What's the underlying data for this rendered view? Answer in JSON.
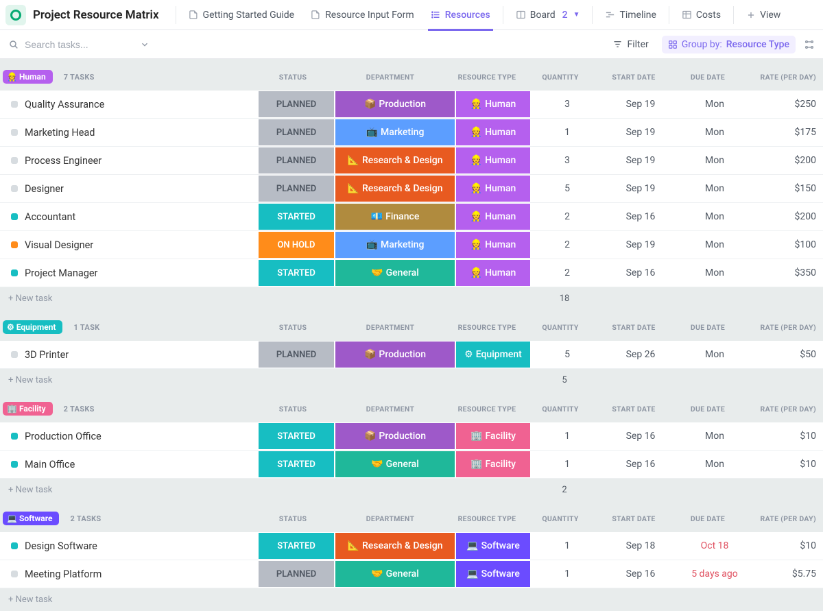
{
  "header": {
    "title": "Project Resource Matrix",
    "tabs": [
      {
        "label": "Getting Started Guide",
        "icon": "📄"
      },
      {
        "label": "Resource Input Form",
        "icon": "📄"
      },
      {
        "label": "Resources",
        "icon": "list",
        "active": true
      },
      {
        "label": "Board",
        "icon": "board",
        "count": "2"
      },
      {
        "label": "Timeline",
        "icon": "timeline"
      },
      {
        "label": "Costs",
        "icon": "table"
      },
      {
        "label": "View",
        "icon": "plus"
      }
    ]
  },
  "toolbar": {
    "search_placeholder": "Search tasks...",
    "filter": "Filter",
    "group_label": "Group by:",
    "group_value": "Resource Type"
  },
  "columns": [
    "STATUS",
    "DEPARTMENT",
    "RESOURCE TYPE",
    "QUANTITY",
    "START DATE",
    "DUE DATE",
    "RATE (PER DAY)"
  ],
  "colors": {
    "status": {
      "PLANNED": "#b7bcc5",
      "STARTED": "#17bec2",
      "ON HOLD": "#ff8c1a"
    },
    "dept": {
      "Production": "#9e59c9",
      "Marketing": "#5c9eff",
      "Research & Design": "#e85a20",
      "Finance": "#b08b3e",
      "General": "#1fb89a"
    },
    "restype": {
      "Human": "#b560ee",
      "Equipment": "#17bec2",
      "Facility": "#f06292",
      "Software": "#6b4cff"
    },
    "groups": {
      "Human": "#b560ee",
      "Equipment": "#17bec2",
      "Facility": "#f06292",
      "Software": "#6b4cff"
    }
  },
  "groups": [
    {
      "name": "Human",
      "emoji": "👷",
      "count": "7 TASKS",
      "rows": [
        {
          "name": "Quality Assurance",
          "dot": "#d7dce0",
          "status": "PLANNED",
          "dept": "Production",
          "dept_emoji": "📦",
          "restype": "Human",
          "restype_emoji": "👷",
          "qty": "3",
          "start": "Sep 19",
          "due": "Mon",
          "rate": "$250"
        },
        {
          "name": "Marketing Head",
          "dot": "#d7dce0",
          "status": "PLANNED",
          "dept": "Marketing",
          "dept_emoji": "📺",
          "restype": "Human",
          "restype_emoji": "👷",
          "qty": "1",
          "start": "Sep 19",
          "due": "Mon",
          "rate": "$175"
        },
        {
          "name": "Process Engineer",
          "dot": "#d7dce0",
          "status": "PLANNED",
          "dept": "Research & Design",
          "dept_emoji": "📐",
          "restype": "Human",
          "restype_emoji": "👷",
          "qty": "3",
          "start": "Sep 19",
          "due": "Mon",
          "rate": "$200"
        },
        {
          "name": "Designer",
          "dot": "#d7dce0",
          "status": "PLANNED",
          "dept": "Research & Design",
          "dept_emoji": "📐",
          "restype": "Human",
          "restype_emoji": "👷",
          "qty": "5",
          "start": "Sep 19",
          "due": "Mon",
          "rate": "$150"
        },
        {
          "name": "Accountant",
          "dot": "#17bec2",
          "status": "STARTED",
          "dept": "Finance",
          "dept_emoji": "💶",
          "restype": "Human",
          "restype_emoji": "👷",
          "qty": "2",
          "start": "Sep 16",
          "due": "Mon",
          "rate": "$200"
        },
        {
          "name": "Visual Designer",
          "dot": "#ff8c1a",
          "status": "ON HOLD",
          "dept": "Marketing",
          "dept_emoji": "📺",
          "restype": "Human",
          "restype_emoji": "👷",
          "qty": "2",
          "start": "Sep 19",
          "due": "Mon",
          "rate": "$100"
        },
        {
          "name": "Project Manager",
          "dot": "#17bec2",
          "status": "STARTED",
          "dept": "General",
          "dept_emoji": "🤝",
          "restype": "Human",
          "restype_emoji": "👷",
          "qty": "2",
          "start": "Sep 16",
          "due": "Mon",
          "rate": "$350"
        }
      ],
      "sum_qty": "18"
    },
    {
      "name": "Equipment",
      "emoji": "⚙",
      "count": "1 TASK",
      "rows": [
        {
          "name": "3D Printer",
          "dot": "#d7dce0",
          "status": "PLANNED",
          "dept": "Production",
          "dept_emoji": "📦",
          "restype": "Equipment",
          "restype_emoji": "⚙",
          "qty": "5",
          "start": "Sep 26",
          "due": "Mon",
          "rate": "$50"
        }
      ],
      "sum_qty": "5"
    },
    {
      "name": "Facility",
      "emoji": "🏢",
      "count": "2 TASKS",
      "rows": [
        {
          "name": "Production Office",
          "dot": "#17bec2",
          "status": "STARTED",
          "dept": "Production",
          "dept_emoji": "📦",
          "restype": "Facility",
          "restype_emoji": "🏢",
          "qty": "1",
          "start": "Sep 16",
          "due": "Mon",
          "rate": "$10"
        },
        {
          "name": "Main Office",
          "dot": "#17bec2",
          "status": "STARTED",
          "dept": "General",
          "dept_emoji": "🤝",
          "restype": "Facility",
          "restype_emoji": "🏢",
          "qty": "1",
          "start": "Sep 16",
          "due": "Mon",
          "rate": "$10"
        }
      ],
      "sum_qty": "2"
    },
    {
      "name": "Software",
      "emoji": "💻",
      "count": "2 TASKS",
      "rows": [
        {
          "name": "Design Software",
          "dot": "#17bec2",
          "status": "STARTED",
          "dept": "Research & Design",
          "dept_emoji": "📐",
          "restype": "Software",
          "restype_emoji": "💻",
          "qty": "1",
          "start": "Sep 18",
          "due": "Oct 18",
          "due_overdue": true,
          "rate": "$10"
        },
        {
          "name": "Meeting Platform",
          "dot": "#d7dce0",
          "status": "PLANNED",
          "dept": "General",
          "dept_emoji": "🤝",
          "restype": "Software",
          "restype_emoji": "💻",
          "qty": "1",
          "start": "Sep 16",
          "due": "5 days ago",
          "due_overdue": true,
          "rate": "$5.75"
        }
      ]
    }
  ],
  "new_task_label": "+ New task"
}
